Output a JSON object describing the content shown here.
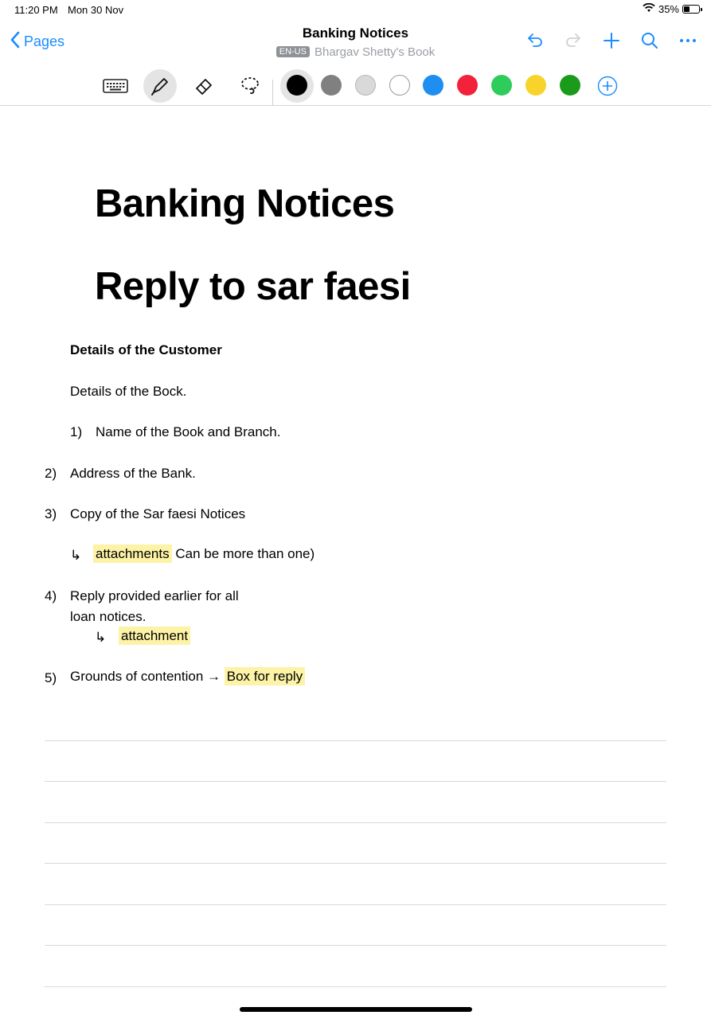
{
  "status": {
    "time": "11:20 PM",
    "date": "Mon 30 Nov",
    "battery": "35%",
    "battery_level": 0.35
  },
  "nav": {
    "back_label": "Pages",
    "title": "Banking Notices",
    "lang": "EN-US",
    "notebook": "Bhargav Shetty's Book",
    "icons": [
      "undo-icon",
      "redo-icon",
      "add-icon",
      "search-icon",
      "more-icon"
    ]
  },
  "toolbar": {
    "tools": [
      "keyboard-icon",
      "pen-icon",
      "eraser-icon",
      "lasso-icon"
    ],
    "active_tool": "pen",
    "colors": [
      "#000000",
      "#808080",
      "#d9d9d9",
      "#ffffff",
      "#1e8ef0",
      "#f1223a",
      "#2ecc5a",
      "#f8d32a",
      "#1a9b1a"
    ],
    "selected_color": "#000000"
  },
  "doc": {
    "title": "Banking Notices",
    "subtitle": "Reply to sar faesi",
    "section": "Details of the Customer",
    "line1": "Details of the Bock.",
    "i1_num": "1)",
    "i1_text": "Name of the Book and Branch.",
    "i2_num": "2)",
    "i2_text": "Address of the Bank.",
    "i3_num": "3)",
    "i3_text": "Copy of the Sar faesi Notices",
    "i3_sub_hl": "attachments",
    "i3_sub_text": "Can be more than one)",
    "i4_num": "4)",
    "i4_text1": "Reply provided earlier for all",
    "i4_text2": "loan notices.",
    "i4_sub_hl": "attachment",
    "i5_num": "5)",
    "i5_text": "Grounds of contention →",
    "i5_hl": "Box for reply",
    "arrow_glyph": "↳"
  }
}
